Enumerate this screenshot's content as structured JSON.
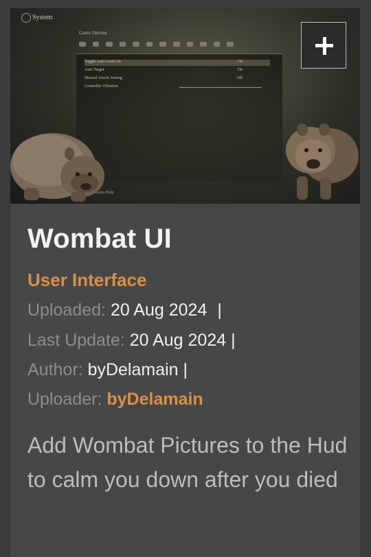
{
  "mod": {
    "title": "Wombat UI",
    "category": "User Interface",
    "uploaded_label": "Uploaded:",
    "uploaded_value": "20 Aug 2024",
    "last_update_label": "Last Update:",
    "last_update_value": "20 Aug 2024",
    "author_label": "Author:",
    "author_value": "byDelamain",
    "uploader_label": "Uploader:",
    "uploader_value": "byDelamain",
    "separator": "|",
    "description": "Add Wombat Pictures to the Hud to calm you down after you died"
  },
  "thumbnail": {
    "system_label": "System",
    "options_header": "Game Options",
    "rows": [
      {
        "label": "Toggle Auto Lock-On",
        "value": "On"
      },
      {
        "label": "Auto Target",
        "value": "On"
      },
      {
        "label": "Manual Attack Aiming",
        "value": "Off"
      },
      {
        "label": "Controller Vibration",
        "value": ""
      }
    ],
    "hint": "Back   Defaults   Help",
    "add_icon": "plus-icon"
  },
  "colors": {
    "page_bg": "#3b3b3b",
    "card_bg": "#474747",
    "accent": "#d9914a",
    "label_gray": "#8d8d8d",
    "text_white": "#f0f0f0"
  }
}
